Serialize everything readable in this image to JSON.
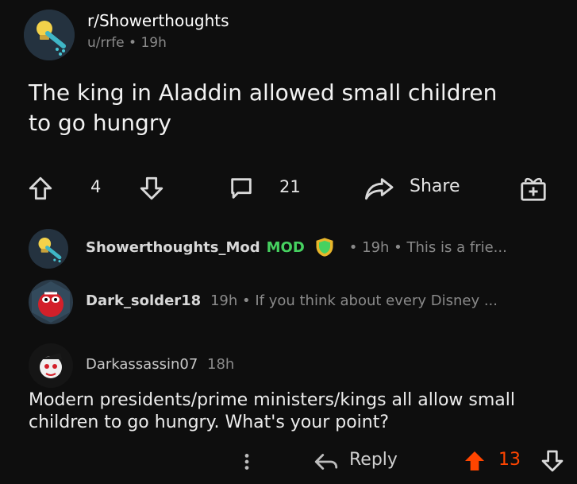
{
  "post": {
    "subreddit": "r/Showerthoughts",
    "author": "u/rrfe",
    "separator": "•",
    "age": "19h",
    "title": "The king in Aladdin allowed small children to go hungry",
    "votes": "4",
    "comments": "21",
    "share_label": "Share"
  },
  "comments": [
    {
      "author": "Showerthoughts_Mod",
      "badge": "MOD",
      "meta": "• 19h • This is a frie..."
    },
    {
      "author": "Dark_solder18",
      "meta": "19h • If you think about every Disney ..."
    },
    {
      "author": "Darkassassin07",
      "age": "18h",
      "body": "Modern presidents/prime ministers/kings all allow small children to go hungry. What's your point?",
      "reply_label": "Reply",
      "score": "13"
    }
  ],
  "colors": {
    "background": "#0e0e0e",
    "text": "#e6e6e6",
    "muted": "#8a8a8a",
    "mod_green": "#46d160",
    "upvote_orange": "#ff4500"
  },
  "icons": [
    "lightbulb-shower-icon",
    "upvote-arrow-icon",
    "downvote-arrow-icon",
    "comment-bubble-icon",
    "share-arrow-icon",
    "gift-award-icon",
    "shield-icon",
    "more-options-icon",
    "reply-arrow-icon"
  ]
}
